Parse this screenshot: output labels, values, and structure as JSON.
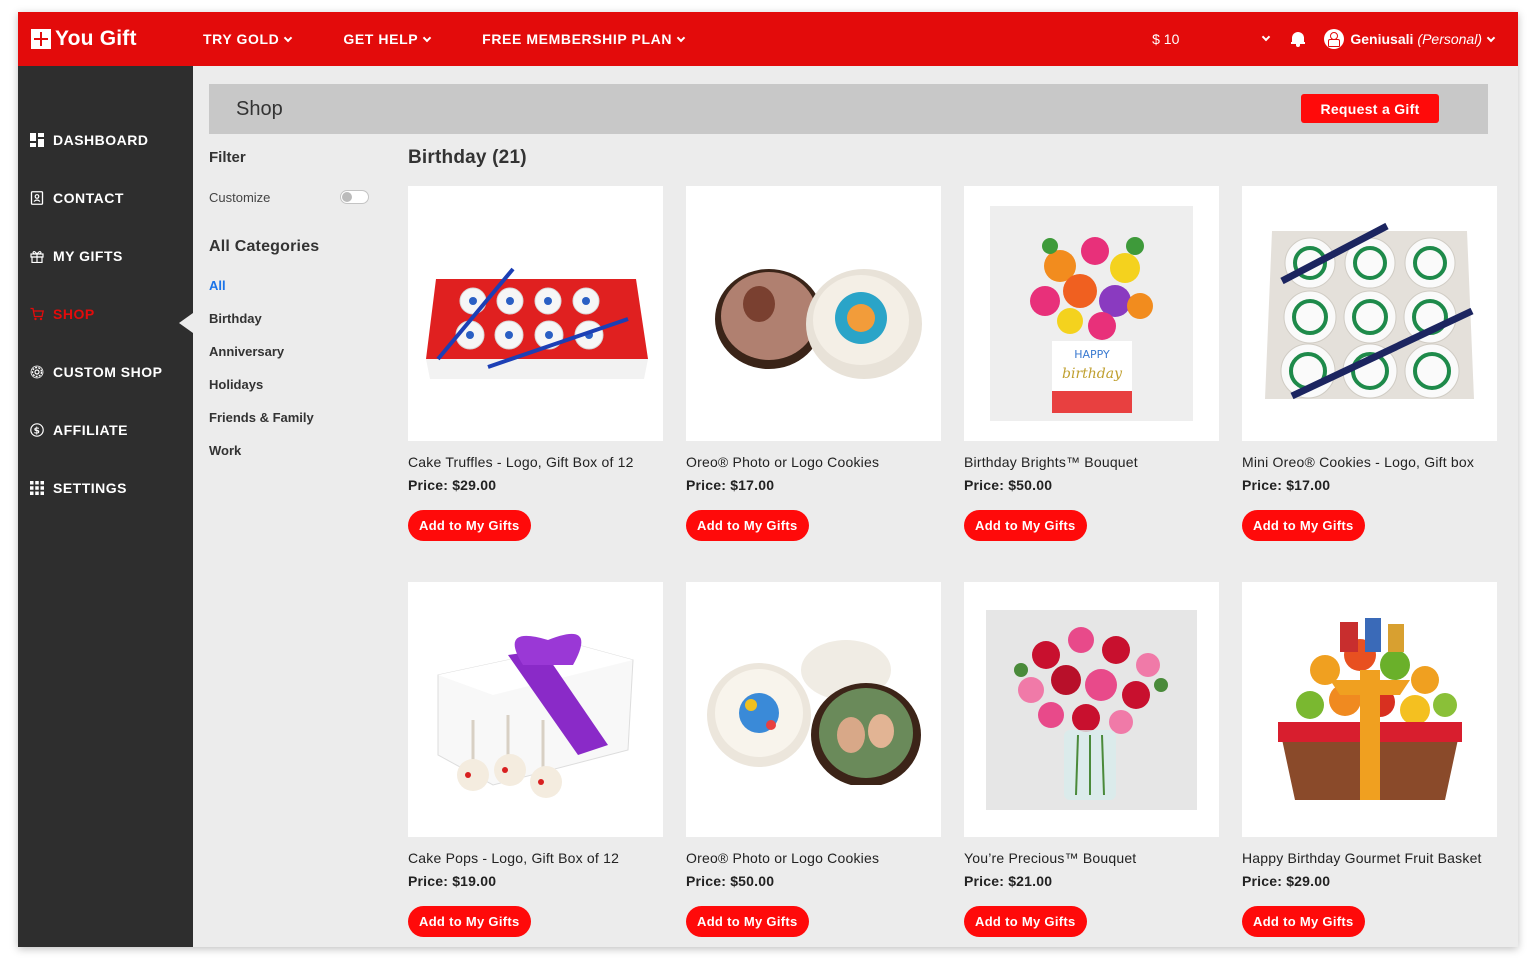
{
  "app": {
    "name": "You Gift"
  },
  "topnav": {
    "items": [
      "TRY GOLD",
      "GET HELP",
      "FREE MEMBERSHIP PLAN"
    ],
    "balance": "$ 10",
    "user_name": "Geniusali",
    "user_type": "(Personal)"
  },
  "sidebar": {
    "items": [
      {
        "label": "DASHBOARD",
        "icon": "dashboard-icon"
      },
      {
        "label": "CONTACT",
        "icon": "contact-book-icon"
      },
      {
        "label": "MY GIFTS",
        "icon": "gift-icon"
      },
      {
        "label": "SHOP",
        "icon": "cart-icon",
        "active": true
      },
      {
        "label": "CUSTOM SHOP",
        "icon": "gear-icon"
      },
      {
        "label": "AFFILIATE",
        "icon": "dollar-circle-icon"
      },
      {
        "label": "SETTINGS",
        "icon": "grid-icon"
      }
    ]
  },
  "shop": {
    "title": "Shop",
    "request_button": "Request a Gift"
  },
  "filter": {
    "title": "Filter",
    "customize_label": "Customize",
    "customize_on": false,
    "categories_title": "All Categories",
    "categories": [
      "All",
      "Birthday",
      "Anniversary",
      "Holidays",
      "Friends & Family",
      "Work"
    ],
    "active_category": "All"
  },
  "section": {
    "title": "Birthday (21)"
  },
  "add_button_label": "Add to My Gifts",
  "colors": {
    "brand_red": "#e30b0b",
    "button_red": "#ff0a0a",
    "sidebar_bg": "#2e2e2e",
    "active_link": "#1a73e8"
  },
  "products": [
    {
      "name": "Cake Truffles - Logo, Gift Box of 12",
      "price": "Price: $29.00"
    },
    {
      "name": "Oreo® Photo or Logo Cookies",
      "price": "Price: $17.00"
    },
    {
      "name": "Birthday Brights™ Bouquet",
      "price": "Price: $50.00"
    },
    {
      "name": "Mini Oreo® Cookies - Logo, Gift box",
      "price": "Price: $17.00"
    },
    {
      "name": "Cake Pops - Logo, Gift Box of 12",
      "price": "Price: $19.00"
    },
    {
      "name": "Oreo® Photo or Logo Cookies",
      "price": "Price: $50.00"
    },
    {
      "name": "You’re Precious™ Bouquet",
      "price": "Price: $21.00"
    },
    {
      "name": "Happy Birthday Gourmet Fruit Basket",
      "price": "Price: $29.00"
    }
  ]
}
